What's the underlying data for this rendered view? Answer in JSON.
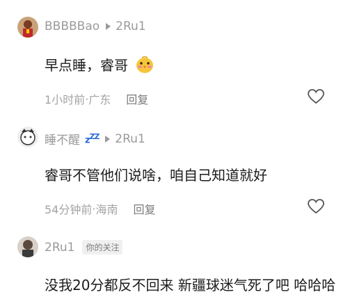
{
  "comments": [
    {
      "username": "BBBBBao",
      "reply_to": "2Ru1",
      "text": "早点睡，睿哥",
      "emoji": "blushing-chick-emoji",
      "time": "1小时前",
      "location": "广东",
      "reply_label": "回复"
    },
    {
      "username": "睡不醒",
      "name_icon": "zzz-icon",
      "reply_to": "2Ru1",
      "text": "睿哥不管他们说啥，咱自己知道就好",
      "time": "54分钟前",
      "location": "海南",
      "reply_label": "回复"
    },
    {
      "username": "2Ru1",
      "badge": "你的关注",
      "text": "没我20分都反不回来 新疆球迷气死了吧 哈哈哈"
    }
  ],
  "separator": "·",
  "colors": {
    "meta": "#a3a3a3",
    "username": "#9a9a9a",
    "text": "#1b1b1b"
  }
}
